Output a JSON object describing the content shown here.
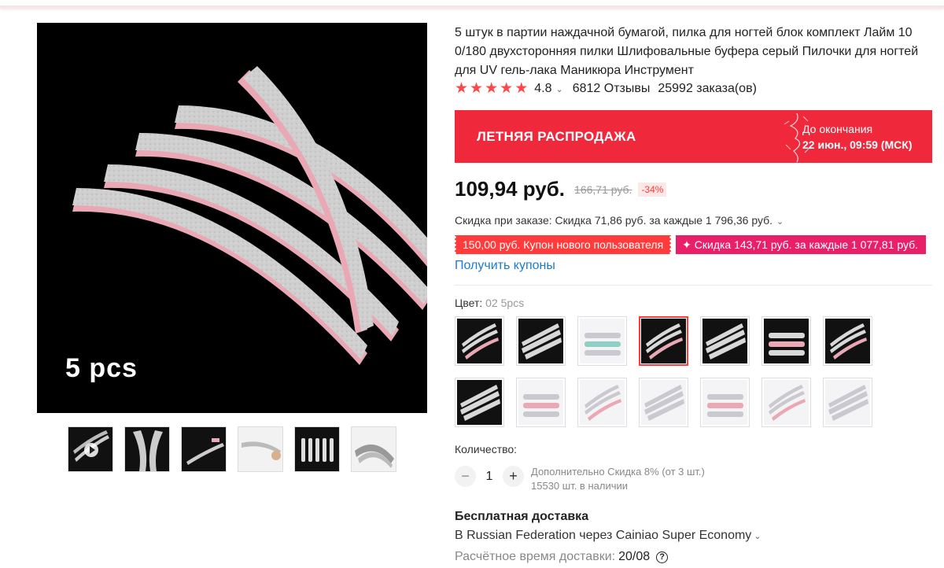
{
  "product": {
    "title": "5 штук в партии наждачной бумагой, пилка для ногтей блок комплект Лайм 10 0/180 двухсторонняя пилки Шлифовальные буфера серый Пилочки для ногтей для UV гель-лака Маникюра Инструмент",
    "rating": "4.8",
    "reviews": "6812 Отзывы",
    "orders": "25992 заказа(ов)",
    "main_image_caption": "5 pcs"
  },
  "sale": {
    "title": "ЛЕТНЯЯ РАСПРОДАЖА",
    "ends_label": "До окончания",
    "ends_value": "22 июн., 09:59 (МСК)",
    "color": "#f0283c"
  },
  "price": {
    "current": "109,94 руб.",
    "old": "166,71 руб.",
    "discount": "-34%"
  },
  "order_discount": "Скидка при заказе: Скидка 71,86 руб. за каждые 1 796,36 руб.",
  "coupons": [
    {
      "label": "150,00 руб. Купон нового пользователя",
      "color": "#ff3b3b"
    },
    {
      "label": "✦ Скидка 143,71 руб. за каждые 1 077,81 руб.",
      "color": "#e8206a"
    }
  ],
  "get_coupons": "Получить купоны",
  "color": {
    "label": "Цвет:",
    "selected": "02 5pcs",
    "selected_index": 3,
    "count": 14
  },
  "quantity": {
    "label": "Количество:",
    "value": "1",
    "minus": "−",
    "plus": "+",
    "promo": "Дополнительно Скидка 8% (от 3 шт.)",
    "stock": "15530 шт. в наличии"
  },
  "shipping": {
    "title": "Бесплатная доставка",
    "via": "В Russian Federation через Cainiao Super Economy",
    "time_label": "Расчётное время доставки:",
    "time_value": "20/08",
    "help": "?"
  },
  "icons": {
    "star": "star-icon",
    "chevron": "chevron-down-icon",
    "help": "question-circle-icon",
    "play": "play-icon"
  }
}
